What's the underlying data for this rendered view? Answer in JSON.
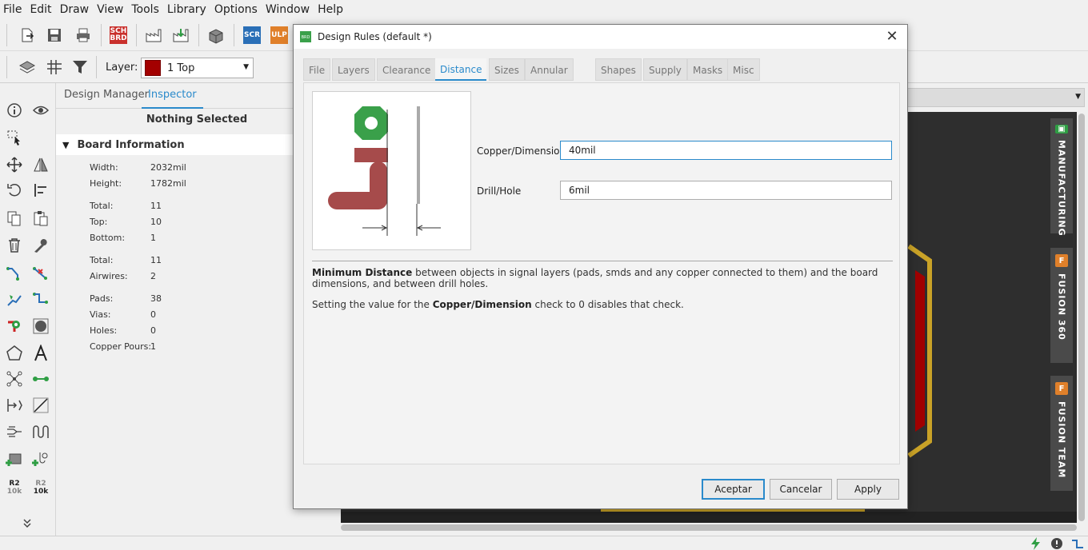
{
  "menu": [
    "File",
    "Edit",
    "Draw",
    "View",
    "Tools",
    "Library",
    "Options",
    "Window",
    "Help"
  ],
  "toolbar": {
    "sch_brd_label": "SCH\nBRD",
    "scr_label": "SCR",
    "ulp_label": "ULP",
    "layer_label": "Layer:",
    "layer_value": "1 Top",
    "layer_color": "#a30000"
  },
  "panel": {
    "tabs": [
      "Design Manager",
      "Inspector"
    ],
    "active_tab": "Inspector",
    "nothing_selected": "Nothing Selected",
    "section_title": "Board Information",
    "props": [
      {
        "k": "Width:",
        "v": "2032mil"
      },
      {
        "k": "Height:",
        "v": "1782mil"
      },
      {
        "k": "Total:",
        "v": "11"
      },
      {
        "k": "Top:",
        "v": "10"
      },
      {
        "k": "Bottom:",
        "v": "1"
      },
      {
        "k": "Total:",
        "v": "11"
      },
      {
        "k": "Airwires:",
        "v": "2"
      },
      {
        "k": "Pads:",
        "v": "38"
      },
      {
        "k": "Vias:",
        "v": "0"
      },
      {
        "k": "Holes:",
        "v": "0"
      },
      {
        "k": "Copper Pours:",
        "v": "1"
      }
    ],
    "tool_labels": {
      "r2": "R2",
      "ohm": "10k"
    }
  },
  "side_tabs": [
    "MANUFACTURING",
    "FUSION 360",
    "FUSION TEAM"
  ],
  "side_tab_icons": {
    "fusion": "F"
  },
  "dialog": {
    "icon_text": "BRD",
    "title": "Design Rules (default *)",
    "close": "✕",
    "tabs": [
      "File",
      "Layers",
      "Clearance",
      "Distance",
      "Sizes",
      "Annular Ring",
      "Shapes",
      "Supply",
      "Masks",
      "Misc"
    ],
    "active_tab": "Distance",
    "fields": {
      "copper_dimension": {
        "label": "Copper/Dimension",
        "value": "40mil"
      },
      "drill_hole": {
        "label": "Drill/Hole",
        "value": "6mil"
      }
    },
    "desc1_bold": "Minimum Distance",
    "desc1_rest": " between objects in signal layers (pads, smds and any copper connected to them) and the board dimensions, and between drill holes.",
    "desc2_pre": "Setting the value for the ",
    "desc2_bold": "Copper/Dimension",
    "desc2_post": " check to 0 disables that check.",
    "buttons": {
      "ok": "Aceptar",
      "cancel": "Cancelar",
      "apply": "Apply"
    }
  },
  "colors": {
    "accent": "#2a8acb",
    "pad_green": "#3aa04a",
    "copper_red": "#a64b4b",
    "board_gold": "#c9a227",
    "board_red": "#a00000"
  }
}
